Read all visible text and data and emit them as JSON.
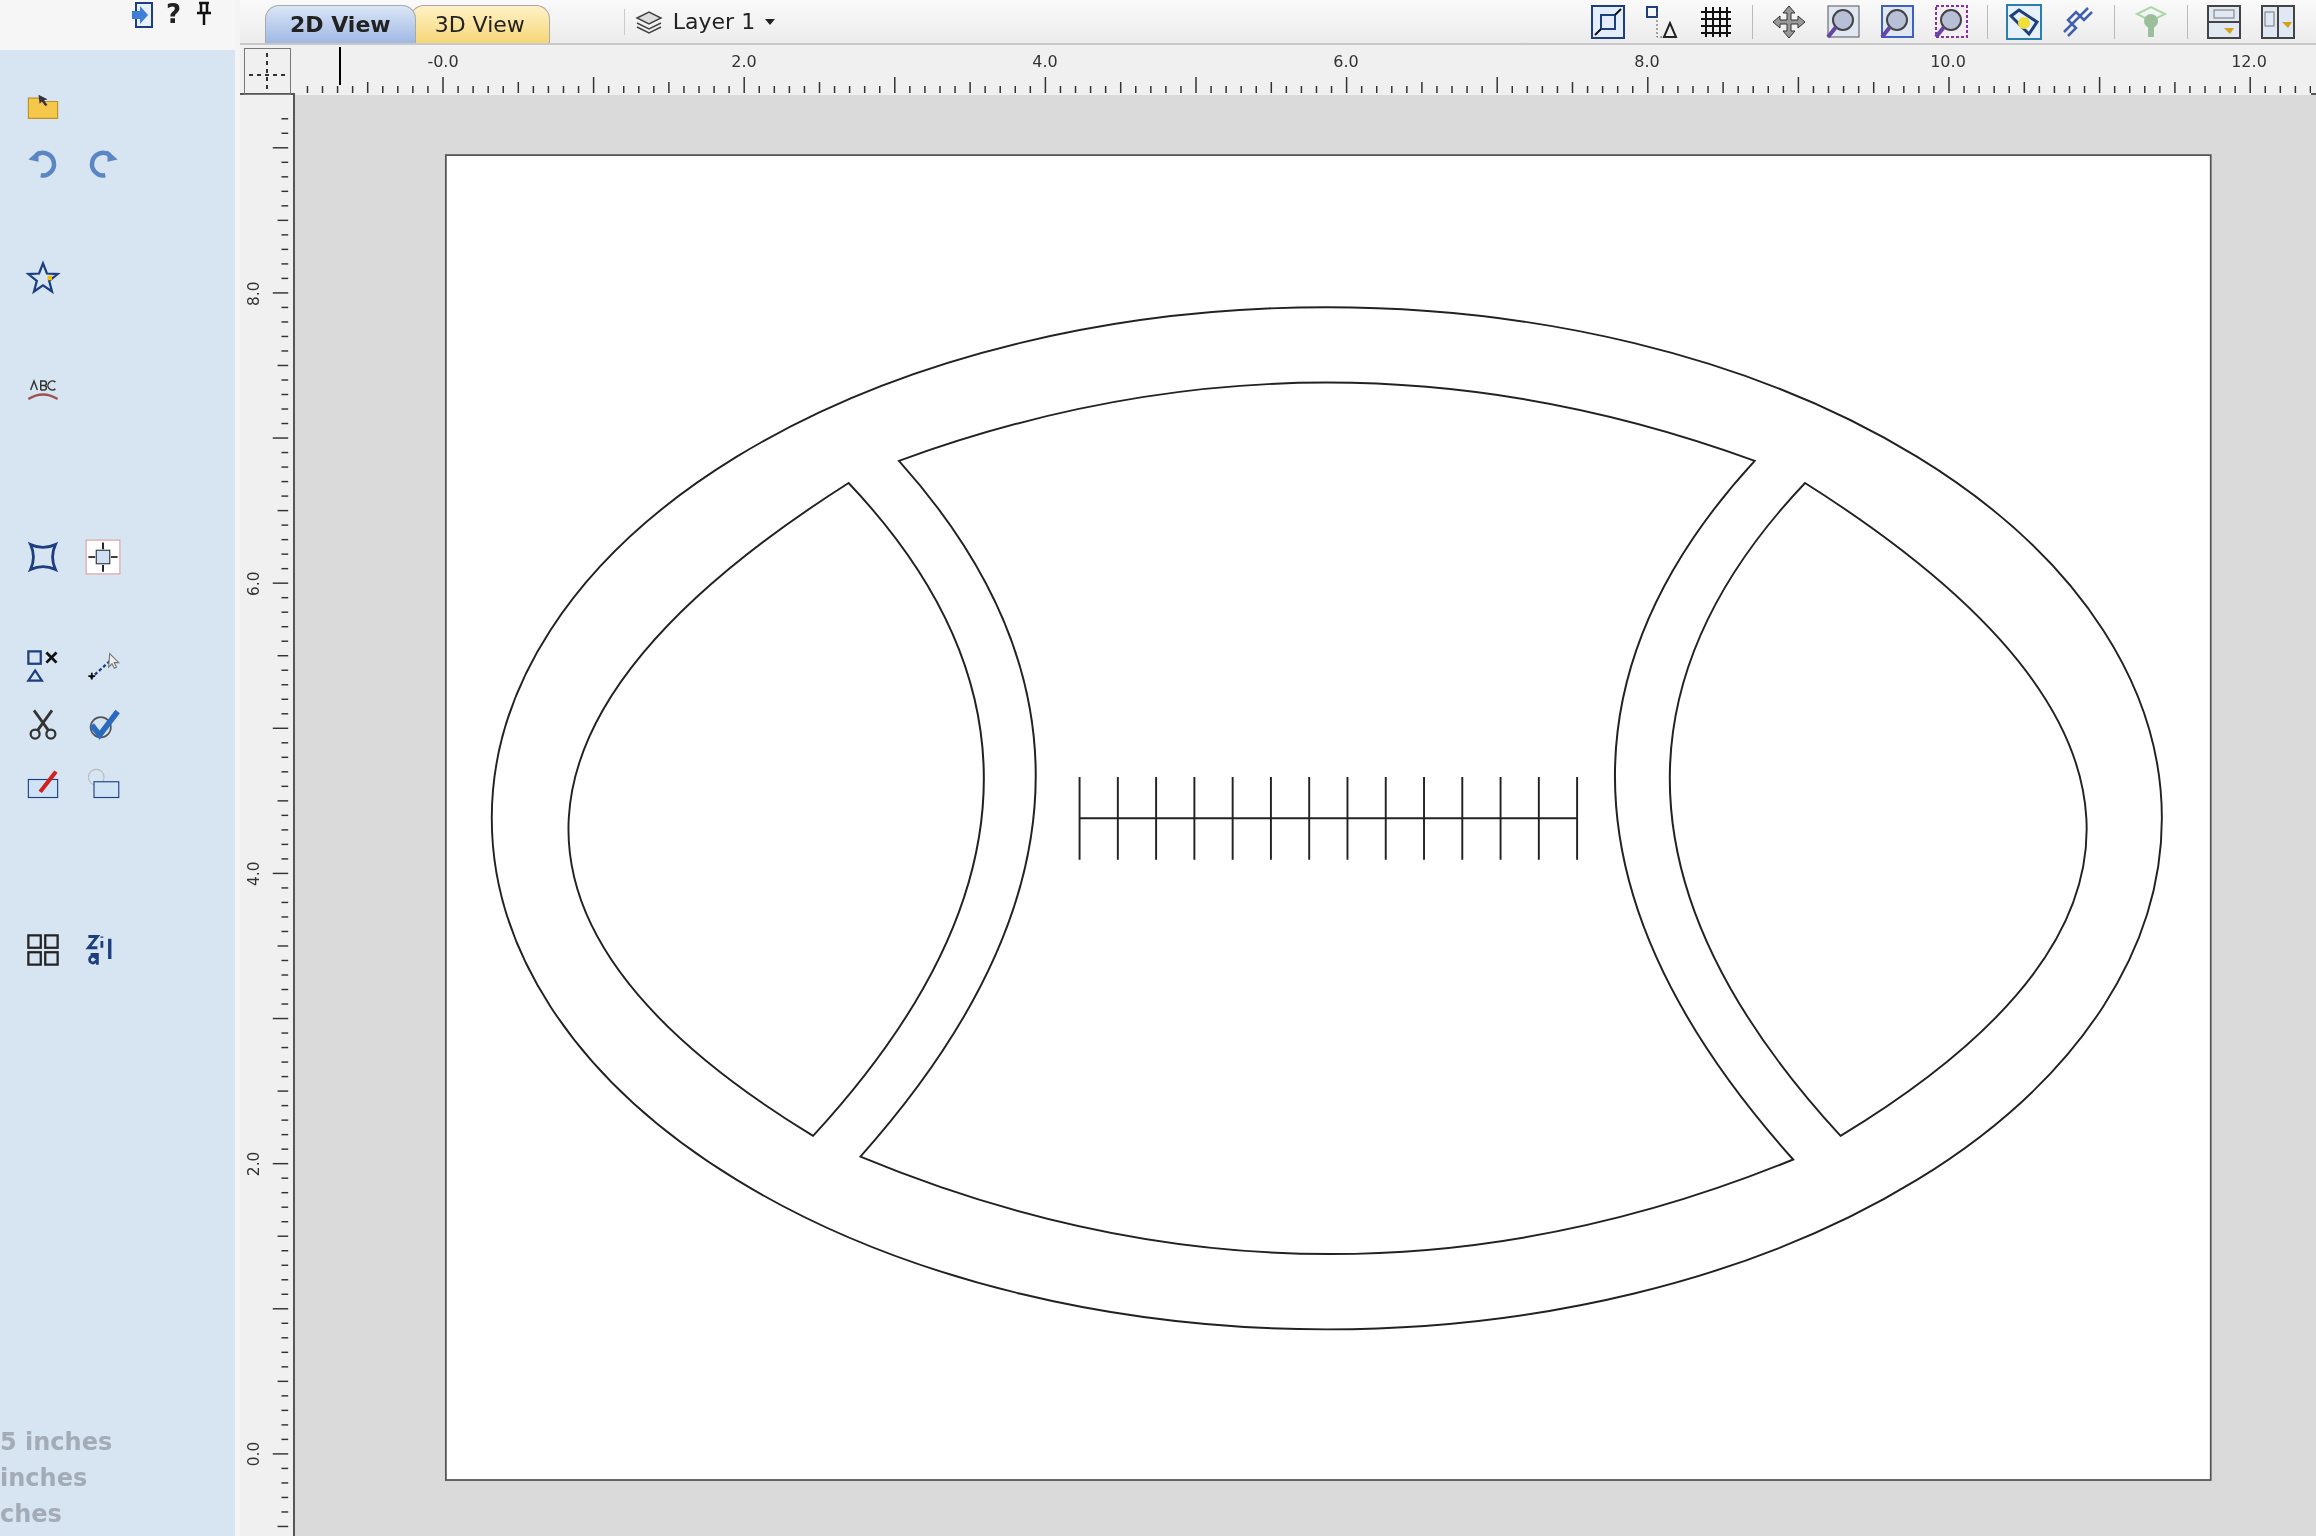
{
  "sidebar": {
    "help_label": "?",
    "units": [
      "5 inches",
      "inches",
      "ches"
    ]
  },
  "tabs": [
    {
      "label": "2D View",
      "selected": true
    },
    {
      "label": "3D View",
      "selected": false
    }
  ],
  "layer": {
    "label": "Layer 1"
  },
  "rulers": {
    "horizontal": [
      "-0.0",
      "2.0",
      "4.0",
      "6.0",
      "8.0",
      "10.0",
      "12.0"
    ],
    "vertical": [
      "0.0",
      "2.0",
      "4.0",
      "6.0",
      "8.0"
    ]
  }
}
